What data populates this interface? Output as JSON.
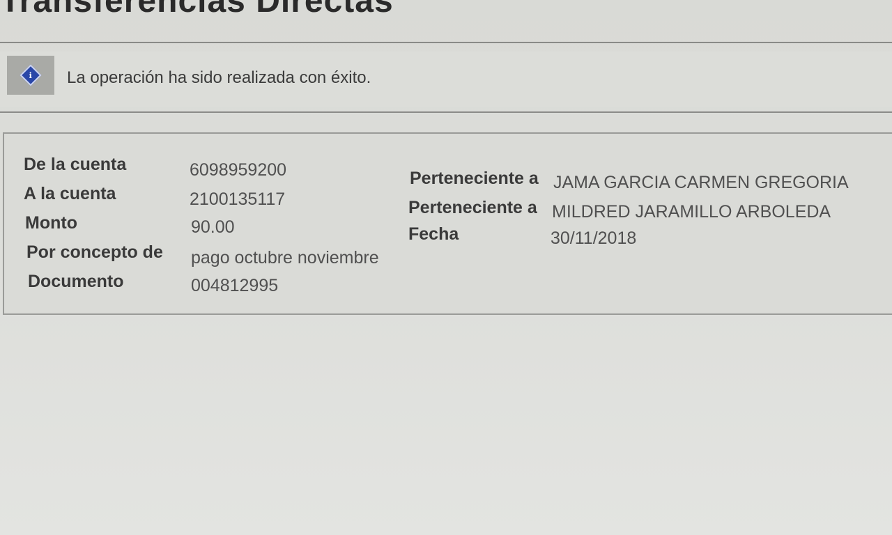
{
  "header": {
    "title": "Transferencias Directas"
  },
  "message": {
    "icon": "info-icon",
    "text": "La operación ha sido realizada con éxito."
  },
  "details": {
    "from_account_label": "De la cuenta",
    "from_account_value": "6098959200",
    "to_account_label": "A la cuenta",
    "to_account_value": "2100135117",
    "amount_label": "Monto",
    "amount_value": "90.00",
    "concept_label": "Por concepto de",
    "concept_value": "pago octubre noviembre",
    "document_label": "Documento",
    "document_value": "004812995",
    "from_owner_label": "Perteneciente a",
    "from_owner_value": "JAMA GARCIA CARMEN GREGORIA",
    "to_owner_label": "Perteneciente a",
    "to_owner_value": "MILDRED JARAMILLO ARBOLEDA",
    "date_label": "Fecha",
    "date_value": "30/11/2018"
  },
  "colors": {
    "info_icon": "#2a47a8",
    "background": "#dcddd9"
  }
}
